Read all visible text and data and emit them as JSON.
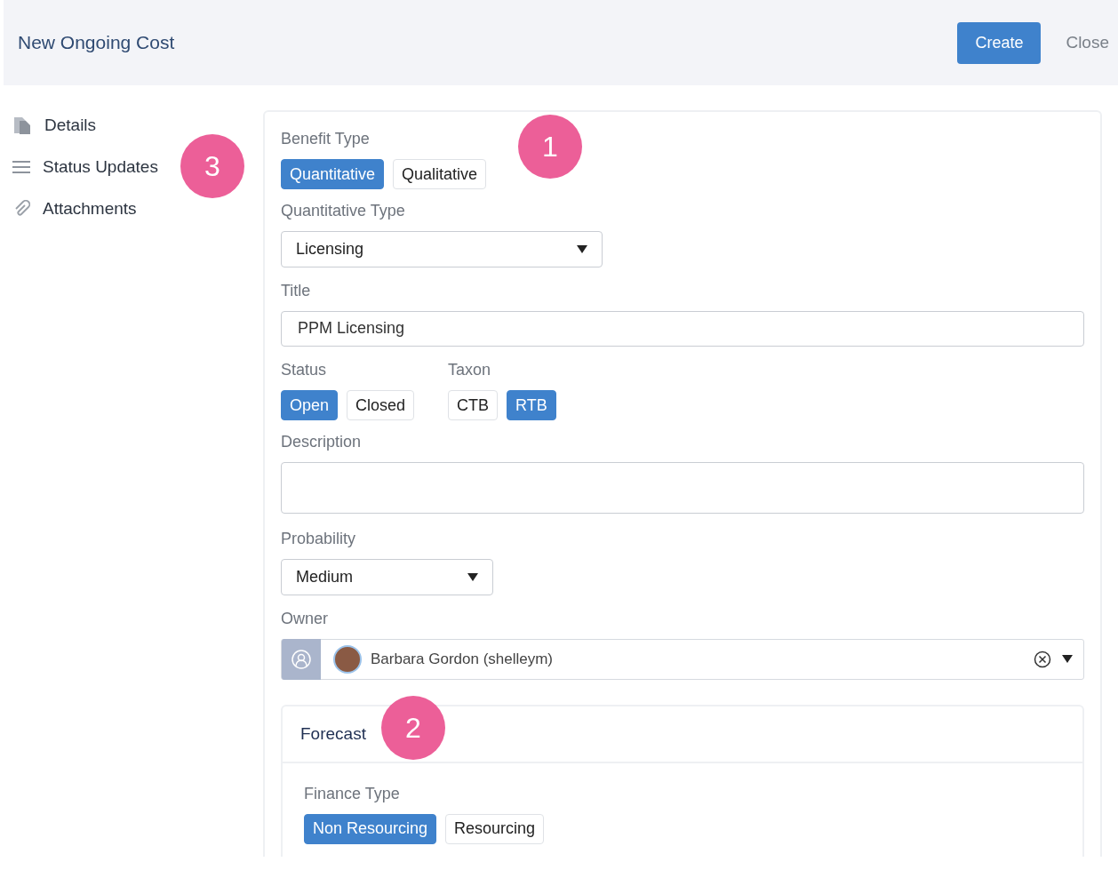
{
  "header": {
    "title": "New Ongoing Cost",
    "create": "Create",
    "close": "Close"
  },
  "sidebar": {
    "items": [
      {
        "label": "Details"
      },
      {
        "label": "Status Updates"
      },
      {
        "label": "Attachments"
      }
    ]
  },
  "form": {
    "benefit_type": {
      "label": "Benefit Type",
      "options": [
        {
          "label": "Quantitative",
          "selected": true
        },
        {
          "label": "Qualitative",
          "selected": false
        }
      ]
    },
    "quantitative_type": {
      "label": "Quantitative Type",
      "value": "Licensing"
    },
    "title": {
      "label": "Title",
      "value": "PPM Licensing"
    },
    "status": {
      "label": "Status",
      "options": [
        {
          "label": "Open",
          "selected": true
        },
        {
          "label": "Closed",
          "selected": false
        }
      ]
    },
    "taxon": {
      "label": "Taxon",
      "options": [
        {
          "label": "CTB",
          "selected": false
        },
        {
          "label": "RTB",
          "selected": true
        }
      ]
    },
    "description": {
      "label": "Description"
    },
    "probability": {
      "label": "Probability",
      "value": "Medium"
    },
    "owner": {
      "label": "Owner",
      "value": "Barbara Gordon (shelleym)"
    },
    "forecast": {
      "title": "Forecast",
      "finance_type": {
        "label": "Finance Type",
        "options": [
          {
            "label": "Non Resourcing",
            "selected": true
          },
          {
            "label": "Resourcing",
            "selected": false
          }
        ]
      }
    }
  },
  "callouts": [
    {
      "label": "1"
    },
    {
      "label": "2"
    },
    {
      "label": "3"
    }
  ]
}
